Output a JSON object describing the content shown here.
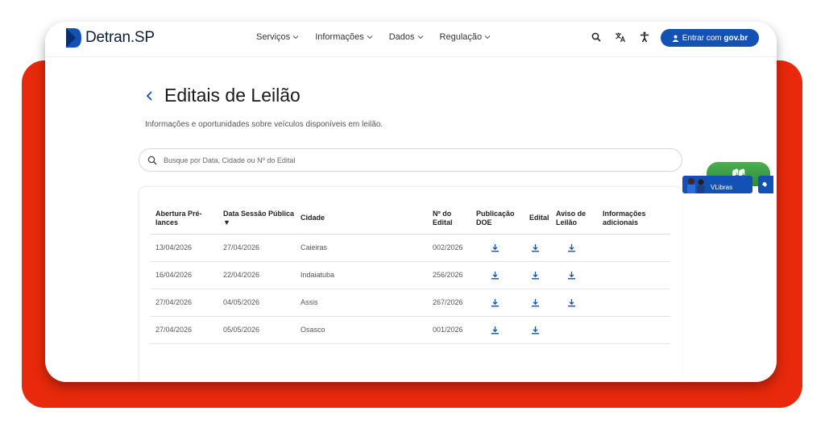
{
  "header": {
    "logo_text": "Detran",
    "logo_suffix": ".SP",
    "nav": [
      {
        "label": "Serviços"
      },
      {
        "label": "Informações"
      },
      {
        "label": "Dados"
      },
      {
        "label": "Regulação"
      }
    ],
    "login_prefix": "Entrar com ",
    "login_brand": "gov.br"
  },
  "page": {
    "title": "Editais de Leilão",
    "subtitle": "Informações e oportunidades sobre veículos disponíveis em leilão."
  },
  "search": {
    "placeholder": "Busque por Data, Cidade ou Nº do Edital"
  },
  "table": {
    "headers": {
      "abertura_l1": "Abertura Pré-",
      "abertura_l2": "lances",
      "sessao_l1": "Data Sessão Pública",
      "sessao_sort": "▼",
      "cidade": "Cidade",
      "edital_no_l1": "Nº do",
      "edital_no_l2": "Edital",
      "publicacao_l1": "Publicação",
      "publicacao_l2": "DOE",
      "edital": "Edital",
      "aviso_l1": "Aviso de",
      "aviso_l2": "Leilão",
      "info_l1": "Informações",
      "info_l2": "adicionais"
    },
    "rows": [
      {
        "abertura": "13/04/2026",
        "sessao": "27/04/2026",
        "cidade": "Caieiras",
        "numero": "002/2026",
        "aviso": true
      },
      {
        "abertura": "16/04/2026",
        "sessao": "22/04/2026",
        "cidade": "Indaiatuba",
        "numero": "256/2026",
        "aviso": true
      },
      {
        "abertura": "27/04/2026",
        "sessao": "04/05/2026",
        "cidade": "Assis",
        "numero": "267/2026",
        "aviso": true
      },
      {
        "abertura": "27/04/2026",
        "sessao": "05/05/2026",
        "cidade": "Osasco",
        "numero": "001/2026",
        "aviso": false
      }
    ]
  },
  "vlibras": {
    "label": "VLibras"
  },
  "colors": {
    "accent": "#1351b4",
    "frame_red": "#e8290b",
    "vlibras_green": "#3c9c46"
  }
}
